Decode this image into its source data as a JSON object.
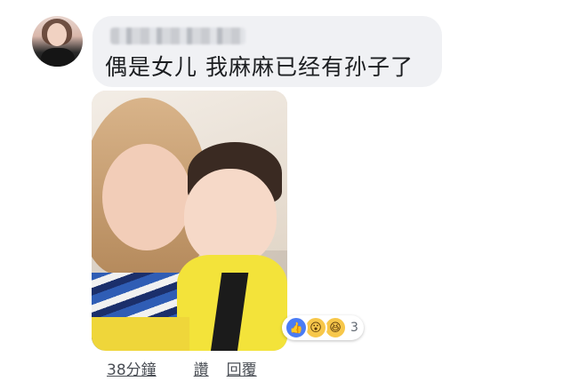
{
  "comment": {
    "text": "偶是女儿 我麻麻已经有孙子了"
  },
  "reactions": {
    "icons": [
      "like-icon",
      "wow-icon",
      "haha-icon"
    ],
    "count": "3"
  },
  "actions": {
    "time_label": "38分鐘",
    "like_label": "讚",
    "reply_label": "回覆"
  },
  "colors": {
    "bubble": "#f0f1f4",
    "like_blue": "#4a7cf5",
    "emoji_yellow": "#f7c74a",
    "text": "#1c1e21",
    "meta": "#4b4f56"
  }
}
